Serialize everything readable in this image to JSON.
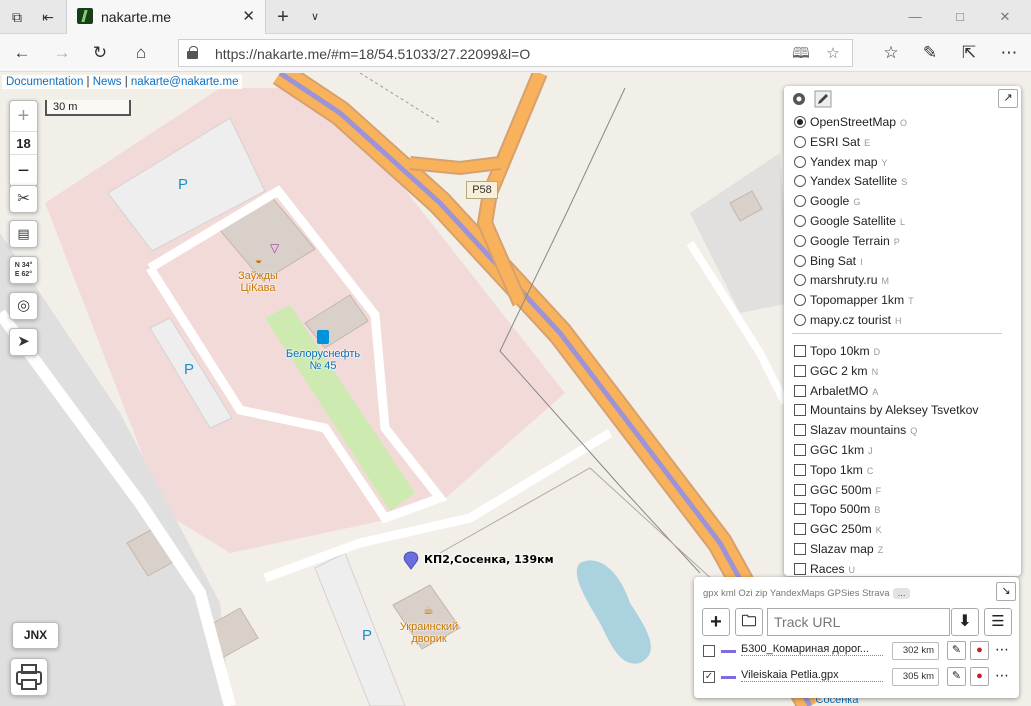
{
  "browser": {
    "tab_title": "nakarte.me",
    "url": "https://nakarte.me/#m=18/54.51033/27.22099&l=O",
    "new_tab_label": "+",
    "menu_label": "⋯"
  },
  "attribution": {
    "documentation": "Documentation",
    "sep1": " | ",
    "news": "News",
    "sep2": " | ",
    "email": "nakarte@nakarte.me"
  },
  "zoom": {
    "plus": "+",
    "level": "18",
    "minus": "−"
  },
  "scale": {
    "label": "30 m"
  },
  "coords_control": {
    "line1": "N 34°",
    "line2": "E 62°"
  },
  "jnx_label": "JNX",
  "map": {
    "road_ref": "P58",
    "poi_cafe": "Заўжды ЦіКава",
    "poi_fuel_line1": "Белоруснефть",
    "poi_fuel_line2": "№ 45",
    "poi_restaurant_line1": "Украинский",
    "poi_restaurant_line2": "дворик",
    "parking": "P",
    "marker_label": "КП2,Сосенка, 139км",
    "bottom_label": "Сосенка"
  },
  "layers": {
    "base": [
      {
        "label": "OpenStreetMap",
        "hotkey": "O",
        "selected": true
      },
      {
        "label": "ESRI Sat",
        "hotkey": "E",
        "selected": false
      },
      {
        "label": "Yandex map",
        "hotkey": "Y",
        "selected": false
      },
      {
        "label": "Yandex Satellite",
        "hotkey": "S",
        "selected": false
      },
      {
        "label": "Google",
        "hotkey": "G",
        "selected": false
      },
      {
        "label": "Google Satellite",
        "hotkey": "L",
        "selected": false
      },
      {
        "label": "Google Terrain",
        "hotkey": "P",
        "selected": false
      },
      {
        "label": "Bing Sat",
        "hotkey": "I",
        "selected": false
      },
      {
        "label": "marshruty.ru",
        "hotkey": "M",
        "selected": false
      },
      {
        "label": "Topomapper 1km",
        "hotkey": "T",
        "selected": false
      },
      {
        "label": "mapy.cz tourist",
        "hotkey": "H",
        "selected": false
      }
    ],
    "overlays": [
      {
        "label": "Topo 10km",
        "hotkey": "D"
      },
      {
        "label": "GGC 2 km",
        "hotkey": "N"
      },
      {
        "label": "ArbaletMO",
        "hotkey": "A"
      },
      {
        "label": "Mountains by Aleksey Tsvetkov",
        "hotkey": ""
      },
      {
        "label": "Slazav mountains",
        "hotkey": "Q"
      },
      {
        "label": "GGC 1km",
        "hotkey": "J"
      },
      {
        "label": "Topo 1km",
        "hotkey": "C"
      },
      {
        "label": "GGC 500m",
        "hotkey": "F"
      },
      {
        "label": "Topo 500m",
        "hotkey": "B"
      },
      {
        "label": "GGC 250m",
        "hotkey": "K"
      },
      {
        "label": "Slazav map",
        "hotkey": "Z"
      },
      {
        "label": "Races",
        "hotkey": "U"
      }
    ]
  },
  "tracks": {
    "formats": "gpx kml Ozi zip YandexMaps GPSies Strava",
    "formats_more": "...",
    "url_placeholder": "Track URL",
    "items": [
      {
        "name": "Б300_Комариная дорог...",
        "length": "302 km",
        "checked": false
      },
      {
        "name": "Vileiskaia Petlia.gpx",
        "length": "305 km",
        "checked": true
      }
    ],
    "colors": {
      "track": "#7b6fe0"
    }
  },
  "colors": {
    "map_background": "#f2efe9",
    "residential": "#f2dad9",
    "trunk_road": "#f9b25c",
    "parking": "#eeeeee",
    "water": "#aad3df",
    "grass": "#cdebb0"
  }
}
